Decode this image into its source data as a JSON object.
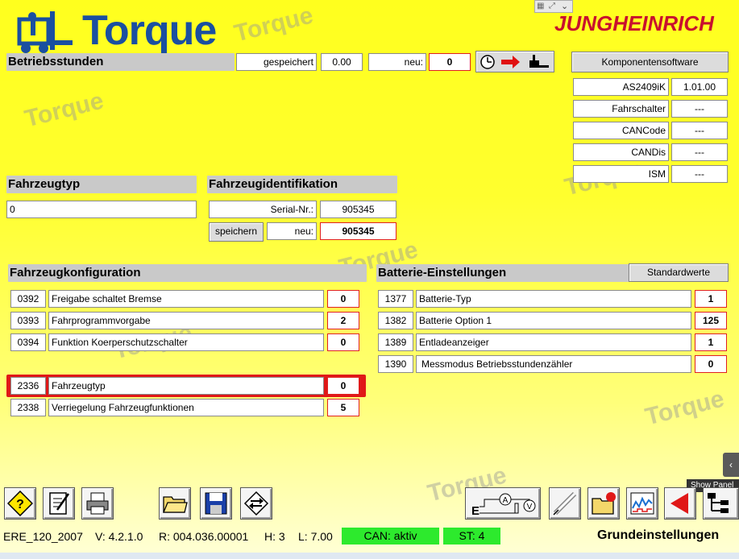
{
  "brand": {
    "logo": "Torque",
    "company": "JUNGHEINRICH"
  },
  "hours": {
    "title": "Betriebsstunden",
    "saved_label": "gespeichert",
    "saved_value": "0.00",
    "new_label": "neu:",
    "new_value": "0"
  },
  "software": {
    "button": "Komponentensoftware",
    "rows": [
      {
        "name": "AS2409iK",
        "value": "1.01.00"
      },
      {
        "name": "Fahrschalter",
        "value": "---"
      },
      {
        "name": "CANCode",
        "value": "---"
      },
      {
        "name": "CANDis",
        "value": "---"
      },
      {
        "name": "ISM",
        "value": "---"
      }
    ]
  },
  "vehicle_type": {
    "title": "Fahrzeugtyp",
    "value": "0"
  },
  "vehicle_id": {
    "title": "Fahrzeugidentifikation",
    "serial_label": "Serial-Nr.:",
    "serial_value": "905345",
    "save_button": "speichern",
    "new_label": "neu:",
    "new_value": "905345"
  },
  "config": {
    "title": "Fahrzeugkonfiguration",
    "rows": [
      {
        "code": "0392",
        "label": "Freigabe schaltet Bremse",
        "value": "0"
      },
      {
        "code": "0393",
        "label": "Fahrprogrammvorgabe",
        "value": "2"
      },
      {
        "code": "0394",
        "label": "Funktion Koerperschutzschalter",
        "value": "0"
      },
      {
        "code": "2336",
        "label": "Fahrzeugtyp",
        "value": "0"
      },
      {
        "code": "2338",
        "label": "Verriegelung Fahrzeugfunktionen",
        "value": "5"
      }
    ]
  },
  "battery": {
    "title": "Batterie-Einstellungen",
    "defaults_button": "Standardwerte",
    "rows": [
      {
        "code": "1377",
        "label": "Batterie-Typ",
        "value": "1"
      },
      {
        "code": "1382",
        "label": "Batterie Option 1",
        "value": "125"
      },
      {
        "code": "1389",
        "label": "Entladeanzeiger",
        "value": "1"
      },
      {
        "code": "1390",
        "label": "Messmodus Betriebsstundenzähler",
        "value": "0"
      }
    ]
  },
  "side_panel": {
    "tooltip": "Show Panel"
  },
  "statusbar": {
    "model": "ERE_120_2007",
    "version": "V: 4.2.1.0",
    "release": "R: 004.036.00001",
    "h": "H: 3",
    "l": "L: 7.00",
    "can": "CAN: aktiv",
    "st": "ST: 4",
    "mode": "Grundeinstellungen"
  },
  "watermark": "Torque",
  "colors": {
    "background": "#ffff1e",
    "header_gray": "#c9c9c9",
    "highlight_red": "#e02020",
    "status_green": "#2dea2d",
    "logo_blue": "#1a4fa0",
    "brand_red": "#c8102e"
  }
}
